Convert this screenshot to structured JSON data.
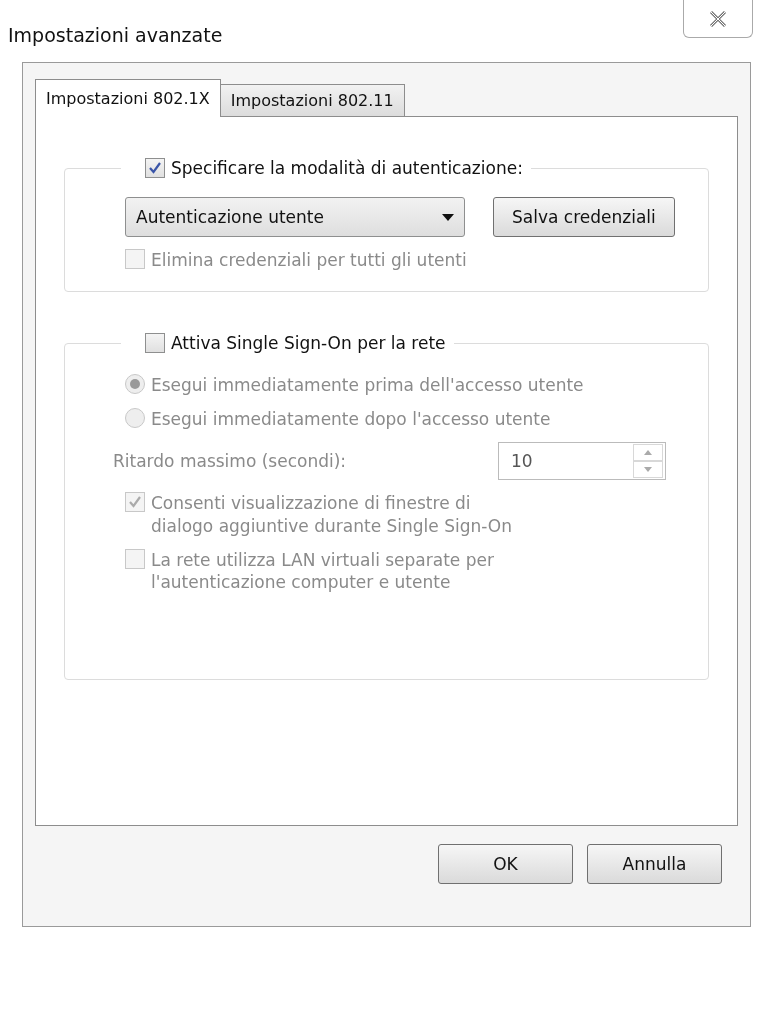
{
  "window": {
    "title": "Impostazioni avanzate"
  },
  "tabs": [
    {
      "label": "Impostazioni 802.1X",
      "selected": true
    },
    {
      "label": "Impostazioni 802.11",
      "selected": false
    }
  ],
  "auth_group": {
    "label": "Specificare la modalità di autenticazione:",
    "checked": true,
    "mode_dropdown": {
      "value": "Autenticazione utente"
    },
    "save_button": "Salva credenziali",
    "delete_option": {
      "label": "Elimina credenziali per tutti gli utenti",
      "checked": false,
      "disabled": true
    }
  },
  "sso_group": {
    "label": "Attiva Single Sign-On per la rete",
    "checked": false,
    "timing_options": [
      {
        "label": "Esegui immediatamente prima dell'accesso utente",
        "selected": true,
        "disabled": true
      },
      {
        "label": "Esegui immediatamente dopo l'accesso utente",
        "selected": false,
        "disabled": true
      }
    ],
    "delay": {
      "label": "Ritardo massimo (secondi):",
      "value": "10",
      "disabled": true
    },
    "options": [
      {
        "label": "Consenti visualizzazione di finestre di dialogo aggiuntive durante Single Sign-On",
        "checked": true,
        "disabled": true
      },
      {
        "label": "La rete utilizza LAN virtuali separate per l'autenticazione computer e utente",
        "checked": false,
        "disabled": true
      }
    ]
  },
  "buttons": [
    "OK",
    "Annulla"
  ]
}
